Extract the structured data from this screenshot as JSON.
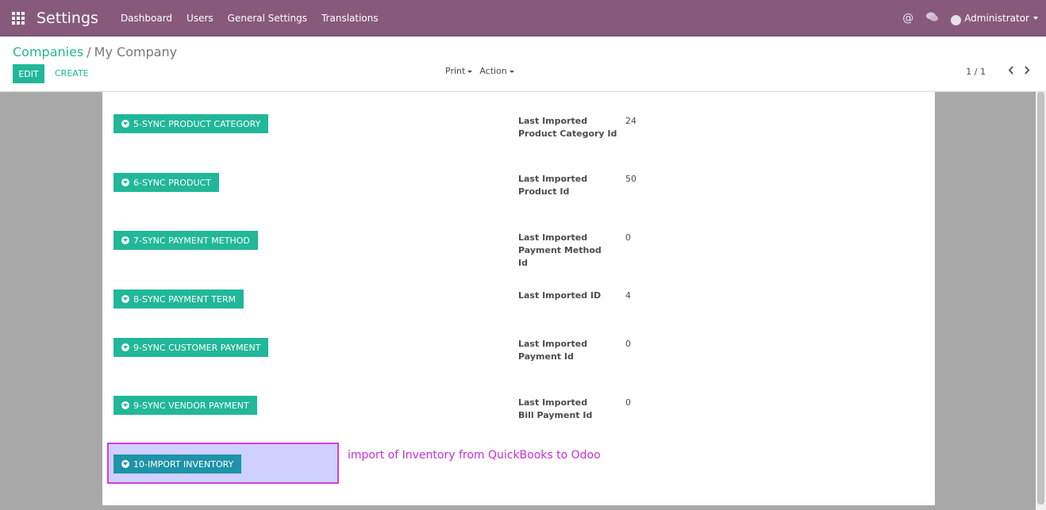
{
  "navbar": {
    "app_title": "Settings",
    "menu": [
      "Dashboard",
      "Users",
      "General Settings",
      "Translations"
    ],
    "user": "Administrator"
  },
  "breadcrumb": {
    "parent": "Companies",
    "separator": "/",
    "current": "My Company"
  },
  "buttons": {
    "edit": "EDIT",
    "create": "CREATE",
    "print": "Print",
    "action": "Action"
  },
  "pager": {
    "value": "1 / 1"
  },
  "sync_rows": [
    {
      "button": "5-SYNC PRODUCT CATEGORY",
      "label": "Last Imported Product Category Id",
      "value": "24"
    },
    {
      "button": "6-SYNC PRODUCT",
      "label": "Last Imported Product Id",
      "value": "50"
    },
    {
      "button": "7-SYNC PAYMENT METHOD",
      "label": "Last Imported Payment Method Id",
      "value": "0"
    },
    {
      "button": "8-SYNC PAYMENT TERM",
      "label": "Last Imported ID",
      "value": "4"
    },
    {
      "button": "9-SYNC CUSTOMER PAYMENT",
      "label": "Last Imported Payment Id",
      "value": "0"
    },
    {
      "button": "9-SYNC VENDOR PAYMENT",
      "label": "Last Imported Bill Payment Id",
      "value": "0"
    }
  ],
  "import_inventory": {
    "button": "10-IMPORT INVENTORY",
    "annotation": "import of Inventory from QuickBooks to Odoo"
  },
  "colors": {
    "navbar": "#875a7b",
    "primary": "#21b799",
    "highlight_border": "#d23fe0",
    "annotation_text": "#c62fd8"
  }
}
